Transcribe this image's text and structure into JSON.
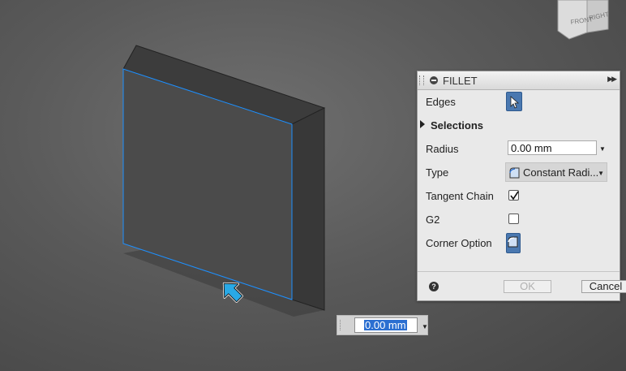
{
  "viewcube": {
    "front_label": "FRONT",
    "right_label": "RIGHT"
  },
  "fillet_panel": {
    "title": "FILLET",
    "edges_label": "Edges",
    "selections_label": "Selections",
    "radius_label": "Radius",
    "radius_value": "0.00 mm",
    "type_label": "Type",
    "type_value": "Constant Radi...",
    "tangent_chain_label": "Tangent Chain",
    "tangent_chain_checked": true,
    "g2_label": "G2",
    "g2_checked": false,
    "corner_option_label": "Corner Option",
    "ok_label": "OK",
    "cancel_label": "Cancel",
    "help_icon": "?"
  },
  "dimension_input": {
    "value": "0.00 mm"
  },
  "colors": {
    "selection_edge": "#1e90ff",
    "accent_button": "#4a78b0",
    "manipulator_arrow": "#29a9e6"
  },
  "icons": [
    "collapse-icon",
    "expand-icon",
    "cursor-select-icon",
    "fillet-type-icon",
    "corner-option-icon",
    "help-icon",
    "chevron-down-icon",
    "fillet-arrow-icon"
  ]
}
